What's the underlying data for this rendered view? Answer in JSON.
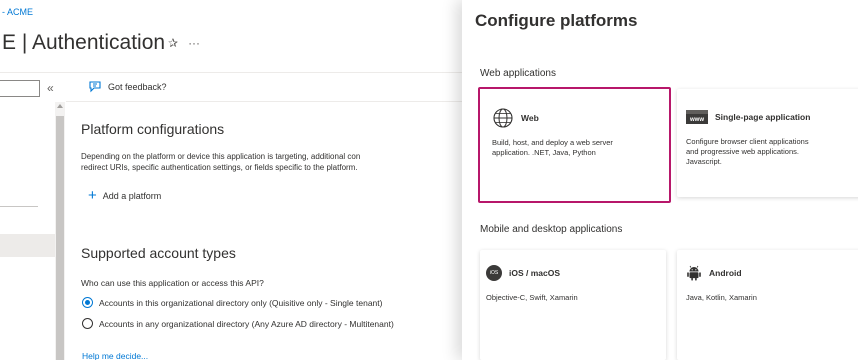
{
  "left": {
    "breadcrumb": "- ACME",
    "title": "E | Authentication",
    "pin_glyph": "✰",
    "more_glyph": "···",
    "collapse_glyph": "«",
    "feedback_label": "Got feedback?",
    "platform": {
      "title": "Platform configurations",
      "desc_line1": "Depending on the platform or device this application is targeting, additional con",
      "desc_line2": "redirect URIs, specific authentication settings, or fields specific to the platform.",
      "add_label": "Add a platform"
    },
    "account": {
      "title": "Supported account types",
      "question": "Who can use this application or access this API?",
      "options": [
        {
          "label": "Accounts in this organizational directory only (Quisitive only - Single tenant)",
          "checked": true
        },
        {
          "label": "Accounts in any organizational directory (Any Azure AD directory - Multitenant)",
          "checked": false
        }
      ],
      "help_link": "Help me decide..."
    }
  },
  "panel": {
    "title": "Configure platforms",
    "web_section": "Web applications",
    "mobile_section": "Mobile and desktop applications",
    "cards": {
      "web": {
        "name": "Web",
        "desc_line1": "Build, host, and deploy a web server",
        "desc_line2": "application. .NET, Java, Python",
        "icon": "globe-icon"
      },
      "spa": {
        "name": "Single-page application",
        "desc_line1": "Configure browser client applications",
        "desc_line2": "and progressive web applications.",
        "desc_line3": "Javascript.",
        "icon_text": "www",
        "icon": "www-icon"
      },
      "ios": {
        "name": "iOS / macOS",
        "desc_line1": "Objective-C, Swift, Xamarin",
        "icon_text": "iOS",
        "icon": "apple-icon"
      },
      "android": {
        "name": "Android",
        "desc_line1": "Java, Kotlin, Xamarin",
        "icon": "android-icon"
      }
    }
  },
  "colors": {
    "accent": "#0078d4",
    "highlight": "#b7176a",
    "text": "#323130"
  }
}
